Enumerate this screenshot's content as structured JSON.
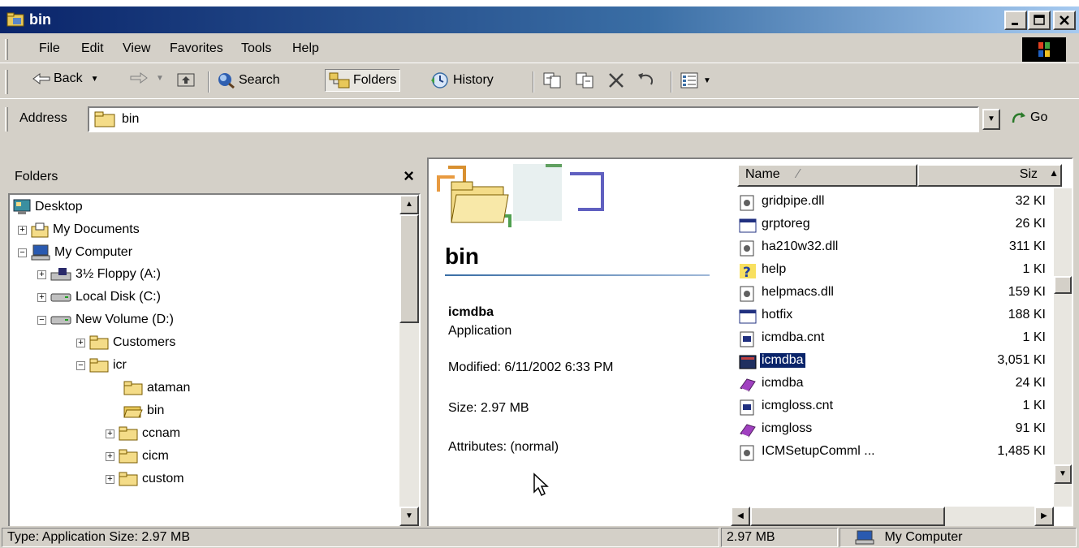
{
  "window": {
    "title": "bin"
  },
  "menu": [
    "File",
    "Edit",
    "View",
    "Favorites",
    "Tools",
    "Help"
  ],
  "toolbar": {
    "back": "Back",
    "search": "Search",
    "folders": "Folders",
    "history": "History"
  },
  "address": {
    "label": "Address",
    "value": "bin",
    "go": "Go"
  },
  "folders": {
    "header": "Folders",
    "tree": [
      "Desktop",
      "My Documents",
      "My Computer",
      "3½ Floppy (A:)",
      "Local Disk (C:)",
      "New Volume (D:)",
      "Customers",
      "icr",
      "ataman",
      "bin",
      "ccnam",
      "cicm",
      "custom"
    ]
  },
  "details": {
    "folder_title": "bin",
    "file_name": "icmdba",
    "file_type": "Application",
    "modified": "Modified: 6/11/2002 6:33 PM",
    "size": "Size: 2.97 MB",
    "attributes": "Attributes: (normal)"
  },
  "list": {
    "col_name": "Name",
    "col_size": "Siz",
    "files": [
      {
        "name": "gridpipe.dll",
        "size": "32 KI",
        "icon": "dll-icon"
      },
      {
        "name": "grptoreg",
        "size": "26 KI",
        "icon": "app-icon"
      },
      {
        "name": "ha210w32.dll",
        "size": "311 KI",
        "icon": "dll-icon"
      },
      {
        "name": "help",
        "size": "1 KI",
        "icon": "help-icon"
      },
      {
        "name": "helpmacs.dll",
        "size": "159 KI",
        "icon": "dll-icon"
      },
      {
        "name": "hotfix",
        "size": "188 KI",
        "icon": "app-icon"
      },
      {
        "name": "icmdba.cnt",
        "size": "1 KI",
        "icon": "cnt-icon"
      },
      {
        "name": "icmdba",
        "size": "3,051 KI",
        "icon": "exe-icon",
        "selected": true
      },
      {
        "name": "icmdba",
        "size": "24 KI",
        "icon": "helpbook-icon"
      },
      {
        "name": "icmgloss.cnt",
        "size": "1 KI",
        "icon": "cnt-icon"
      },
      {
        "name": "icmgloss",
        "size": "91 KI",
        "icon": "helpbook-icon"
      },
      {
        "name": "ICMSetupComml ...",
        "size": "1,485 KI",
        "icon": "dll-icon"
      }
    ]
  },
  "status": {
    "left": "Type: Application Size: 2.97 MB",
    "size": "2.97 MB",
    "zone": "My Computer"
  }
}
